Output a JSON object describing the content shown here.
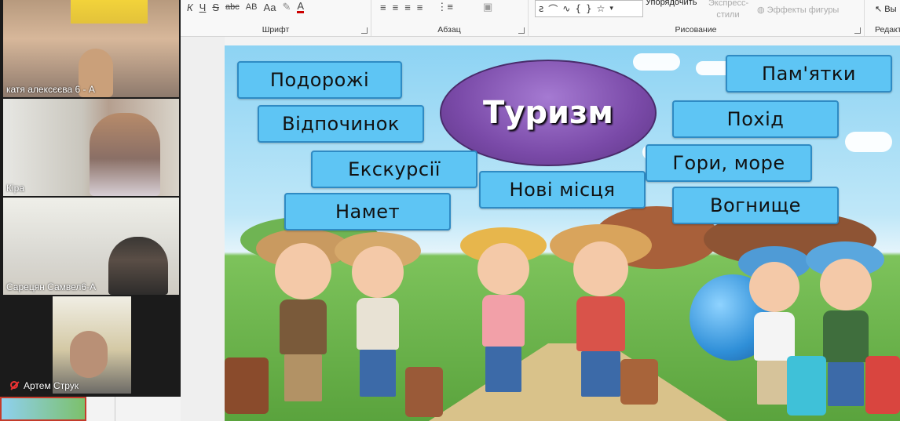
{
  "ribbon": {
    "font_group": "Шрифт",
    "paragraph_group": "Абзац",
    "drawing_group": "Рисование",
    "editing_group": "Редакт",
    "arrange_label": "Упорядочить",
    "express_styles": "Экспресс-стили",
    "shape_effects": "Эффекты фигуры",
    "select_label": "Вы",
    "font_buttons": [
      "К",
      "Ч",
      "S",
      "abc",
      "АВ",
      "Аа"
    ],
    "shape_symbols": [
      "{",
      "}",
      "☆"
    ]
  },
  "participants": [
    {
      "name": "катя алексєєва 6 - А"
    },
    {
      "name": "Кіра"
    },
    {
      "name": "Сарецян Самвел6-А"
    },
    {
      "name": "Артем Струк",
      "muted": true
    }
  ],
  "slide": {
    "title": "Туризм",
    "chips": [
      "Подорожі",
      "Відпочинок",
      "Екскурсії",
      "Намет",
      "Нові місця",
      "Пам'ятки",
      "Похід",
      "Гори, море",
      "Вогнище"
    ]
  },
  "colors": {
    "chip_fill": "#5ec5f4",
    "chip_border": "#2f8bc4",
    "oval_fill": "#7a4aa8",
    "muted_mic": "#e33333"
  }
}
